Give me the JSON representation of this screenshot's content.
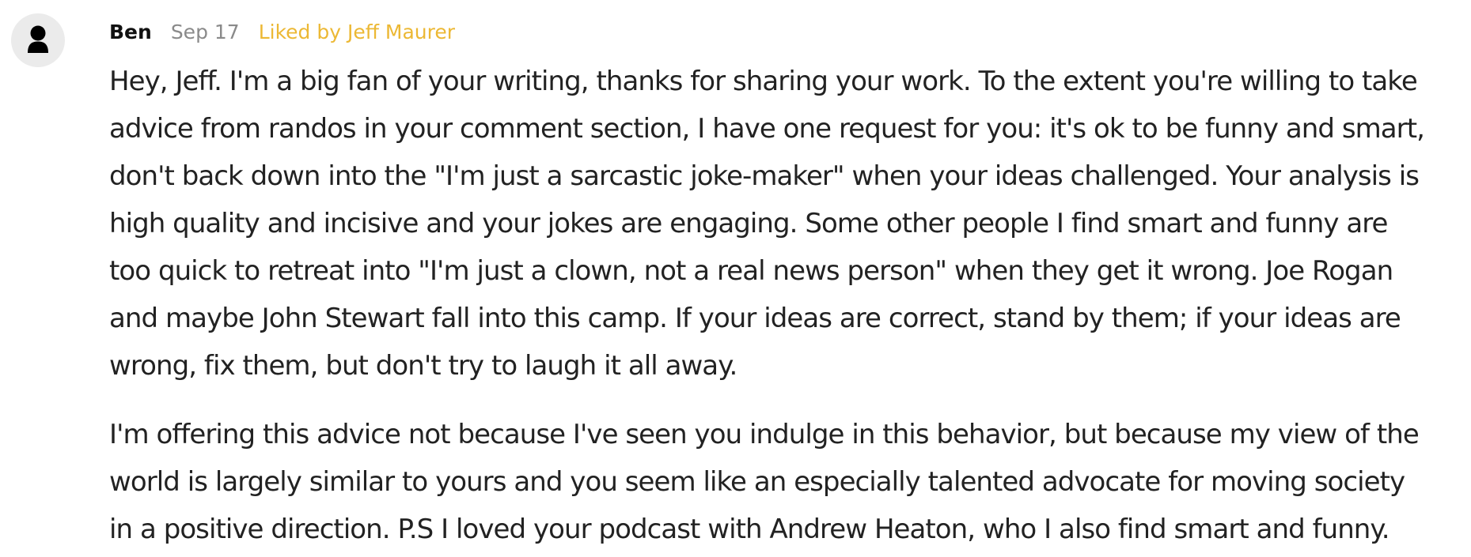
{
  "comment": {
    "author": "Ben",
    "date": "Sep 17",
    "liked_by": "Liked by Jeff Maurer",
    "avatar_icon": "default-user-icon",
    "paragraphs": [
      {
        "lines": [
          "Hey, Jeff. I'm a big fan of your writing, thanks for sharing your work. To the extent you're willing to take",
          "advice from randos in your comment section, I have one request for you: it's ok to be funny and smart,",
          "don't back down into the \"I'm just a sarcastic joke-maker\" when your ideas challenged. Your analysis is",
          "high quality and incisive and your jokes are engaging. Some other people I find smart and funny are",
          "too quick to retreat into \"I'm just a clown, not a real news person\" when they get it wrong. Joe Rogan",
          "and maybe John Stewart fall into this camp. If your ideas are correct, stand by them; if your ideas are",
          "wrong, fix them, but don't try to laugh it all away."
        ]
      },
      {
        "lines": [
          "I'm offering this advice not because I've seen you indulge in this behavior, but because my view of the",
          "world is largely similar to yours and you seem like an especially talented advocate for moving society",
          "in a positive direction. P.S I loved your podcast with Andrew Heaton, who I also find smart and funny."
        ]
      }
    ]
  },
  "colors": {
    "liked_text": "#ecb834",
    "date_text": "#8a8a8a",
    "avatar_background": "#ebebeb",
    "avatar_figure": "#000000"
  }
}
